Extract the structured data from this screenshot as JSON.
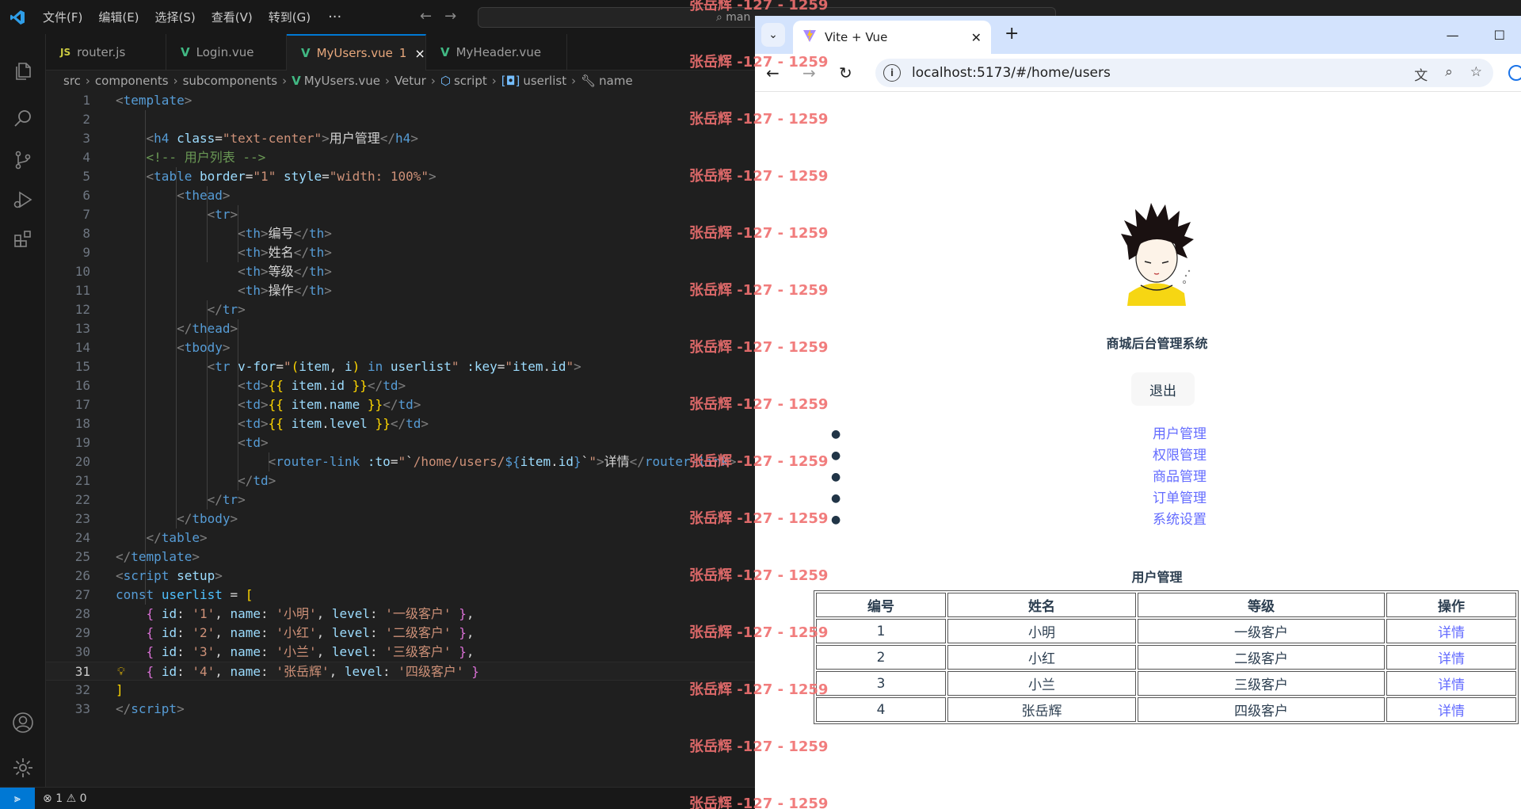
{
  "vscode": {
    "menu": [
      "文件(F)",
      "编辑(E)",
      "选择(S)",
      "查看(V)",
      "转到(G)"
    ],
    "menu_more": "···",
    "search_text": "man",
    "tabs": [
      {
        "icon": "JS",
        "label": "router.js",
        "active": false
      },
      {
        "icon": "V",
        "label": "Login.vue",
        "active": false
      },
      {
        "icon": "V",
        "label": "MyUsers.vue",
        "active": true,
        "badge": "1"
      },
      {
        "icon": "V",
        "label": "MyHeader.vue",
        "active": false
      }
    ],
    "breadcrumb": [
      "src",
      "components",
      "subcomponents",
      "MyUsers.vue",
      "Vetur",
      "script",
      "userlist",
      "name"
    ],
    "current_line": 31,
    "status": {
      "errors": "1",
      "warnings": "0"
    }
  },
  "browser": {
    "tab_title": "Vite + Vue",
    "url": "localhost:5173/#/home/users",
    "page": {
      "app_title": "商城后台管理系统",
      "logout_label": "退出",
      "nav": [
        "用户管理",
        "权限管理",
        "商品管理",
        "订单管理",
        "系统设置"
      ],
      "users_title": "用户管理",
      "table": {
        "headers": [
          "编号",
          "姓名",
          "等级",
          "操作"
        ],
        "rows": [
          [
            "1",
            "小明",
            "一级客户",
            "详情"
          ],
          [
            "2",
            "小红",
            "二级客户",
            "详情"
          ],
          [
            "3",
            "小兰",
            "三级客户",
            "详情"
          ],
          [
            "4",
            "张岳辉",
            "四级客户",
            "详情"
          ]
        ]
      }
    }
  },
  "watermark": "张岳辉 -127 - 1259",
  "colors": {
    "accent": "#0078d4",
    "link": "#646cff",
    "vue_green": "#41b883",
    "watermark": "#f07070"
  }
}
